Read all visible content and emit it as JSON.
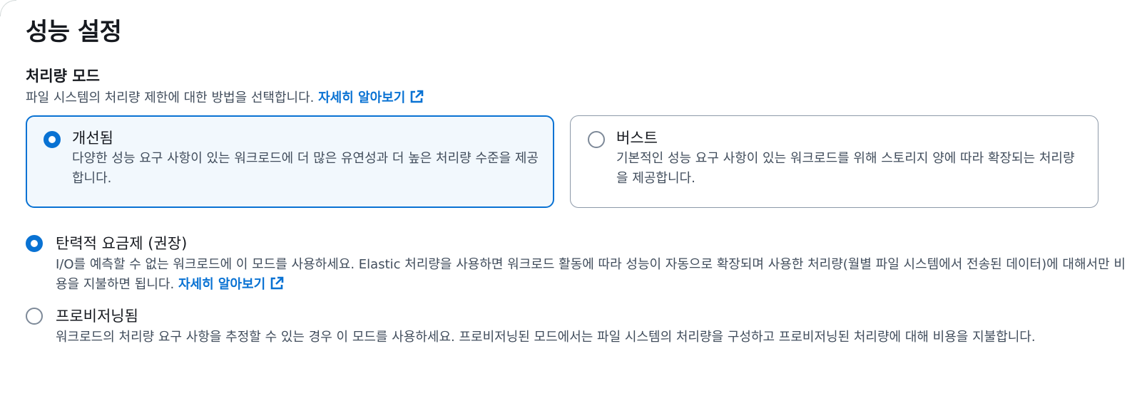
{
  "section": {
    "title": "성능 설정"
  },
  "throughput_mode": {
    "label": "처리량 모드",
    "description": "파일 시스템의 처리량 제한에 대한 방법을 선택합니다.",
    "learn_more": "자세히 알아보기"
  },
  "tiles": [
    {
      "title": "개선됨",
      "description": "다양한 성능 요구 사항이 있는 워크로드에 더 많은 유연성과 더 높은 처리량 수준을 제공합니다.",
      "selected": true
    },
    {
      "title": "버스트",
      "description": "기본적인 성능 요구 사항이 있는 워크로드를 위해 스토리지 양에 따라 확장되는 처리량을 제공합니다.",
      "selected": false
    }
  ],
  "options": [
    {
      "title": "탄력적 요금제 (권장)",
      "description": "I/O를 예측할 수 없는 워크로드에 이 모드를 사용하세요. Elastic 처리량을 사용하면 워크로드 활동에 따라 성능이 자동으로 확장되며 사용한 처리량(월별 파일 시스템에서 전송된 데이터)에 대해서만 비용을 지불하면 됩니다.",
      "learn_more": "자세히 알아보기",
      "selected": true
    },
    {
      "title": "프로비저닝됨",
      "description": "워크로드의 처리량 요구 사항을 추정할 수 있는 경우 이 모드를 사용하세요. 프로비저닝된 모드에서는 파일 시스템의 처리량을 구성하고 프로비저닝된 처리량에 대해 비용을 지불합니다.",
      "selected": false
    }
  ],
  "colors": {
    "accent": "#0972d3",
    "selected_tile_bg": "#f2f8fd",
    "text": "#16191f",
    "secondary_text": "#414d5c",
    "border": "#8d99a8"
  }
}
